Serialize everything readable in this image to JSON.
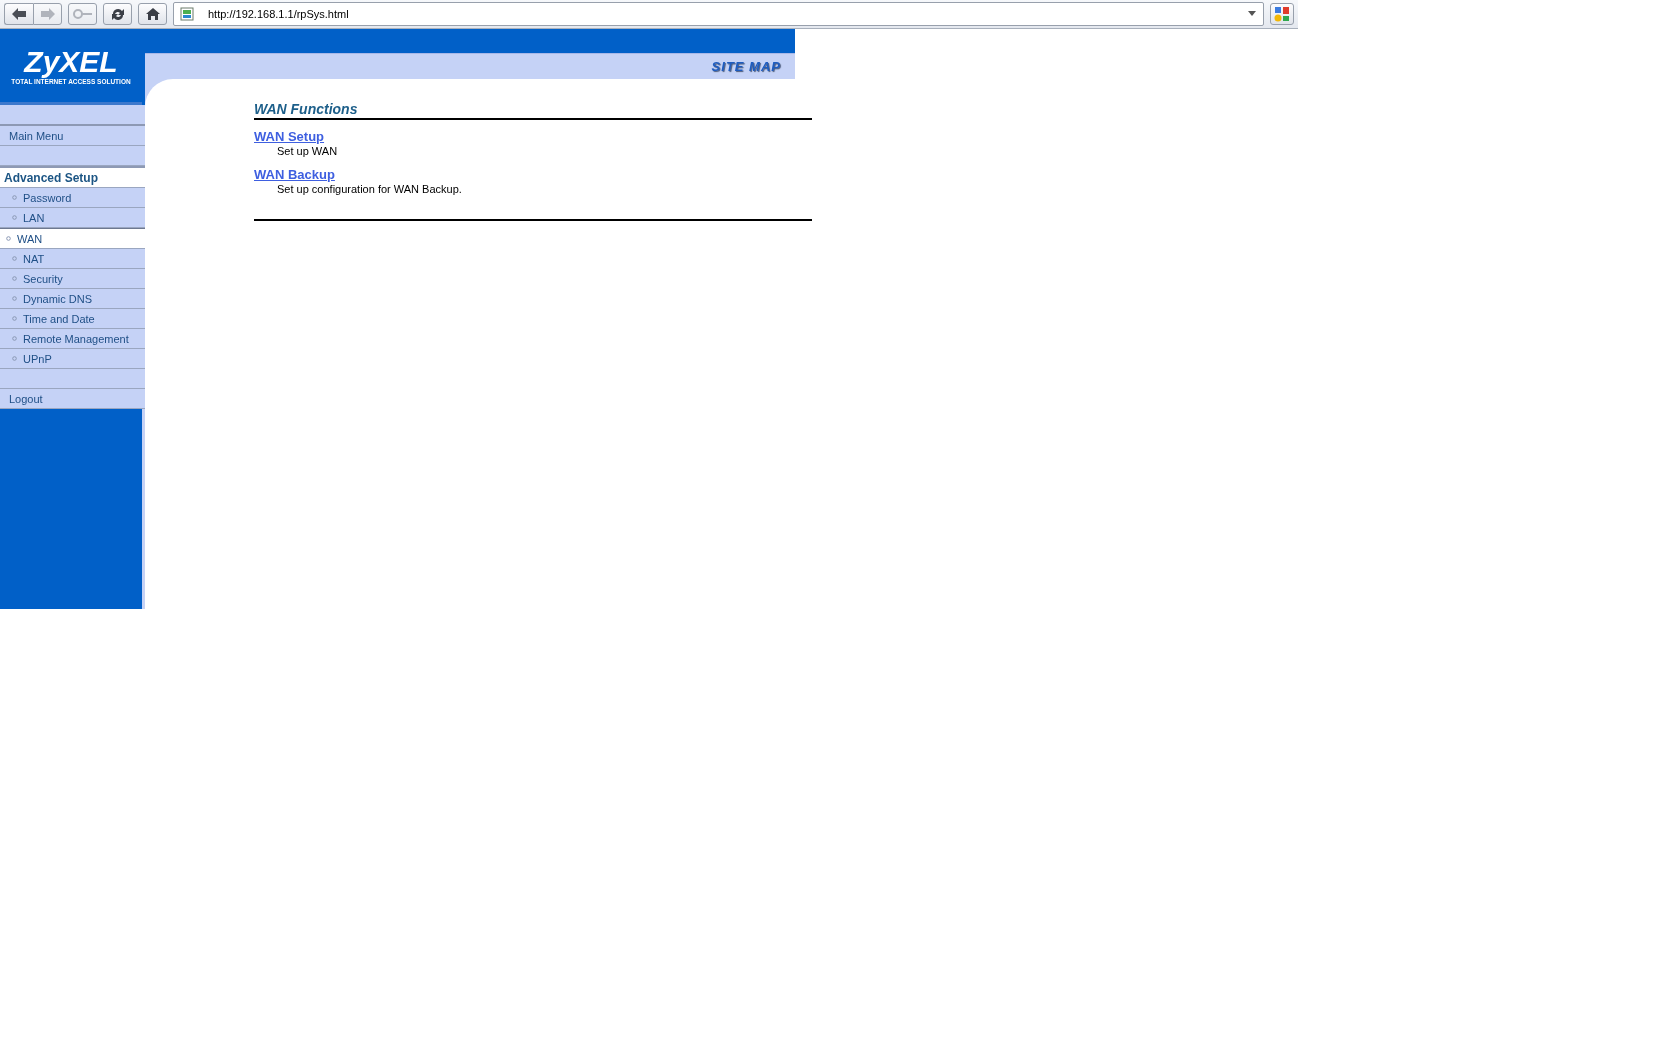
{
  "browser": {
    "url": "http://192.168.1.1/rpSys.html",
    "buttons": [
      {
        "kind": "back",
        "disabled": false
      },
      {
        "kind": "forward",
        "disabled": true
      },
      {
        "kind": "key",
        "disabled": true
      },
      {
        "kind": "reload",
        "disabled": false
      },
      {
        "kind": "home",
        "disabled": false
      }
    ]
  },
  "logo": {
    "name": "ZyXEL",
    "tagline": "TOTAL INTERNET ACCESS SOLUTION"
  },
  "header": {
    "title": "SITE MAP"
  },
  "sidebar": {
    "top": [
      {
        "label": "Main Menu"
      }
    ],
    "section": {
      "title": "Advanced Setup",
      "items": [
        {
          "label": "Password",
          "selected": false
        },
        {
          "label": "LAN",
          "selected": false
        },
        {
          "label": "WAN",
          "selected": true
        },
        {
          "label": "NAT",
          "selected": false
        },
        {
          "label": "Security",
          "selected": false
        },
        {
          "label": "Dynamic DNS",
          "selected": false
        },
        {
          "label": "Time and Date",
          "selected": false
        },
        {
          "label": "Remote Management",
          "selected": false
        },
        {
          "label": "UPnP",
          "selected": false
        }
      ]
    },
    "bottom": [
      {
        "label": "Logout"
      }
    ]
  },
  "content": {
    "heading": "WAN Functions",
    "entries": [
      {
        "link": "WAN Setup",
        "description": "Set up WAN"
      },
      {
        "link": "WAN Backup",
        "description": "Set up configuration for WAN Backup."
      }
    ]
  }
}
